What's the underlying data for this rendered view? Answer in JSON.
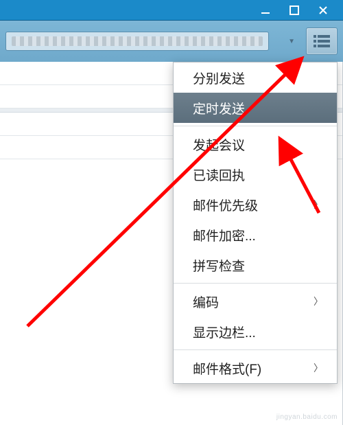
{
  "toolbar": {
    "account_text": "",
    "menu_button_label": "菜单"
  },
  "menu": {
    "items": [
      {
        "label": "分别发送",
        "submenu": false,
        "selected": false
      },
      {
        "label": "定时发送",
        "submenu": false,
        "selected": true
      },
      {
        "label": "发起会议",
        "submenu": false,
        "selected": false
      },
      {
        "label": "已读回执",
        "submenu": false,
        "selected": false
      },
      {
        "label": "邮件优先级",
        "submenu": true,
        "selected": false
      },
      {
        "label": "邮件加密...",
        "submenu": false,
        "selected": false
      },
      {
        "label": "拼写检查",
        "submenu": false,
        "selected": false
      },
      {
        "label": "编码",
        "submenu": true,
        "selected": false
      },
      {
        "label": "显示边栏...",
        "submenu": false,
        "selected": false
      },
      {
        "label": "邮件格式(F)",
        "submenu": true,
        "selected": false
      }
    ],
    "separators_after": [
      1,
      6,
      8
    ]
  },
  "annotations": {
    "arrow_color": "#ff0000"
  },
  "watermark": "jingyan.baidu.com"
}
